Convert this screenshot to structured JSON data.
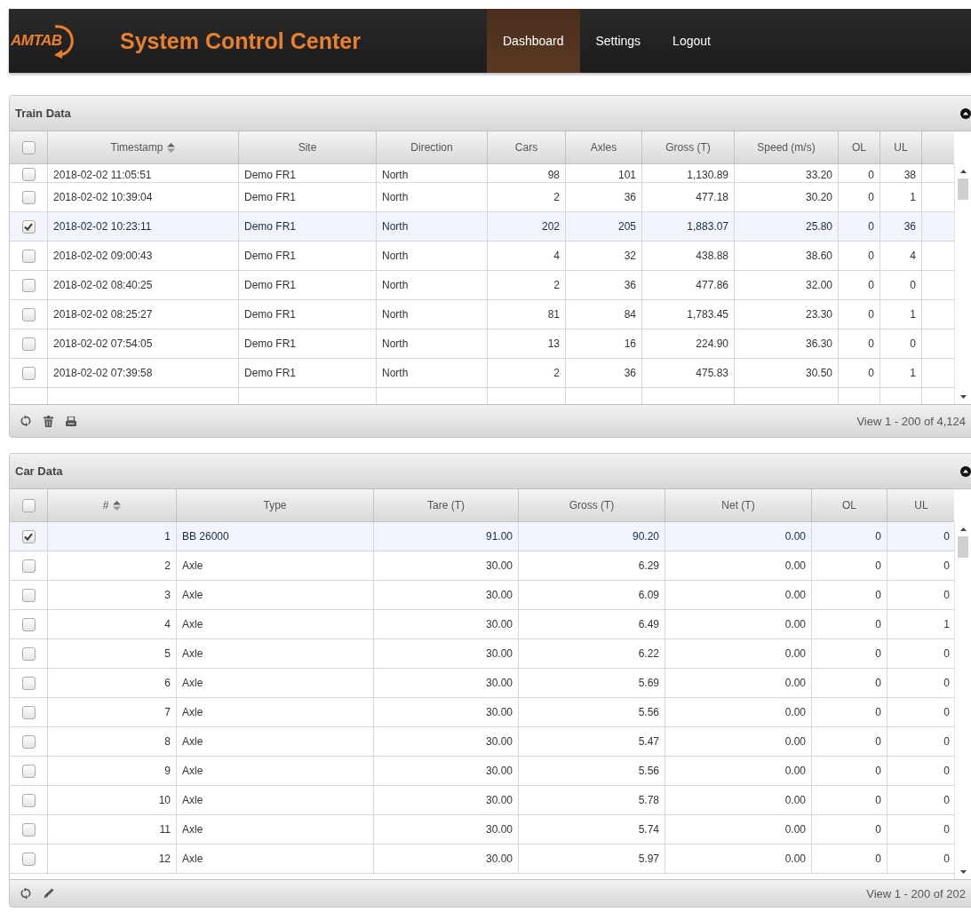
{
  "header": {
    "logo_text": "AMTAB",
    "title": "System Control Center",
    "nav": [
      {
        "label": "Dashboard",
        "selected": true
      },
      {
        "label": "Settings",
        "selected": false
      },
      {
        "label": "Logout",
        "selected": false
      }
    ]
  },
  "panels": [
    {
      "title": "Train Data",
      "select_all_checked": false,
      "columns": [
        {
          "label": "Timestamp",
          "kind": "text",
          "sorted": true
        },
        {
          "label": "Site",
          "kind": "text",
          "sorted": false
        },
        {
          "label": "Direction",
          "kind": "text",
          "sorted": false
        },
        {
          "label": "Cars",
          "kind": "number",
          "sorted": false
        },
        {
          "label": "Axles",
          "kind": "number",
          "sorted": false
        },
        {
          "label": "Gross (T)",
          "kind": "number",
          "sorted": false
        },
        {
          "label": "Speed (m/s)",
          "kind": "number",
          "sorted": false
        },
        {
          "label": "OL",
          "kind": "number",
          "sorted": false
        },
        {
          "label": "UL",
          "kind": "number",
          "sorted": false
        },
        {
          "kind": "blank"
        }
      ],
      "rows": [
        {
          "cells": [
            "2018-02-02 11:05:51",
            "Demo FR1",
            "North",
            "98",
            "101",
            "1,130.89",
            "33.20",
            "0",
            "38",
            ""
          ],
          "checked": false,
          "selected": false
        },
        {
          "cells": [
            "2018-02-02 10:39:04",
            "Demo FR1",
            "North",
            "2",
            "36",
            "477.18",
            "30.20",
            "0",
            "1",
            ""
          ],
          "checked": false,
          "selected": false
        },
        {
          "cells": [
            "2018-02-02 10:23:11",
            "Demo FR1",
            "North",
            "202",
            "205",
            "1,883.07",
            "25.80",
            "0",
            "36",
            ""
          ],
          "checked": true,
          "selected": true
        },
        {
          "cells": [
            "2018-02-02 09:00:43",
            "Demo FR1",
            "North",
            "4",
            "32",
            "438.88",
            "38.60",
            "0",
            "4",
            ""
          ],
          "checked": false,
          "selected": false
        },
        {
          "cells": [
            "2018-02-02 08:40:25",
            "Demo FR1",
            "North",
            "2",
            "36",
            "477.86",
            "32.00",
            "0",
            "0",
            ""
          ],
          "checked": false,
          "selected": false
        },
        {
          "cells": [
            "2018-02-02 08:25:27",
            "Demo FR1",
            "North",
            "81",
            "84",
            "1,783.45",
            "23.30",
            "0",
            "1",
            ""
          ],
          "checked": false,
          "selected": false
        },
        {
          "cells": [
            "2018-02-02 07:54:05",
            "Demo FR1",
            "North",
            "13",
            "16",
            "224.90",
            "36.30",
            "0",
            "0",
            ""
          ],
          "checked": false,
          "selected": false
        },
        {
          "cells": [
            "2018-02-02 07:39:58",
            "Demo FR1",
            "North",
            "2",
            "36",
            "475.83",
            "30.50",
            "0",
            "1",
            ""
          ],
          "checked": false,
          "selected": false
        }
      ],
      "tools": [
        {
          "kind": "refresh"
        },
        {
          "kind": "delete"
        },
        {
          "kind": "print"
        }
      ],
      "pager": "View 1 - 200 of 4,124"
    },
    {
      "title": "Car Data",
      "select_all_checked": false,
      "columns": [
        {
          "label": "#",
          "kind": "number",
          "sorted": true
        },
        {
          "label": "Type",
          "kind": "text",
          "sorted": false
        },
        {
          "label": "Tare (T)",
          "kind": "number",
          "sorted": false
        },
        {
          "label": "Gross (T)",
          "kind": "number",
          "sorted": false
        },
        {
          "label": "Net (T)",
          "kind": "number",
          "sorted": false
        },
        {
          "label": "OL",
          "kind": "number",
          "sorted": false
        },
        {
          "label": "UL",
          "kind": "number",
          "sorted": false
        }
      ],
      "rows": [
        {
          "cells": [
            "1",
            "BB 26000",
            "91.00",
            "90.20",
            "0.00",
            "0",
            "0"
          ],
          "checked": true,
          "selected": true
        },
        {
          "cells": [
            "2",
            "Axle",
            "30.00",
            "6.29",
            "0.00",
            "0",
            "0"
          ],
          "checked": false,
          "selected": false
        },
        {
          "cells": [
            "3",
            "Axle",
            "30.00",
            "6.09",
            "0.00",
            "0",
            "0"
          ],
          "checked": false,
          "selected": false
        },
        {
          "cells": [
            "4",
            "Axle",
            "30.00",
            "6.49",
            "0.00",
            "0",
            "1"
          ],
          "checked": false,
          "selected": false
        },
        {
          "cells": [
            "5",
            "Axle",
            "30.00",
            "6.22",
            "0.00",
            "0",
            "0"
          ],
          "checked": false,
          "selected": false
        },
        {
          "cells": [
            "6",
            "Axle",
            "30.00",
            "5.69",
            "0.00",
            "0",
            "0"
          ],
          "checked": false,
          "selected": false
        },
        {
          "cells": [
            "7",
            "Axle",
            "30.00",
            "5.56",
            "0.00",
            "0",
            "0"
          ],
          "checked": false,
          "selected": false
        },
        {
          "cells": [
            "8",
            "Axle",
            "30.00",
            "5.47",
            "0.00",
            "0",
            "0"
          ],
          "checked": false,
          "selected": false
        },
        {
          "cells": [
            "9",
            "Axle",
            "30.00",
            "5.56",
            "0.00",
            "0",
            "0"
          ],
          "checked": false,
          "selected": false
        },
        {
          "cells": [
            "10",
            "Axle",
            "30.00",
            "5.78",
            "0.00",
            "0",
            "0"
          ],
          "checked": false,
          "selected": false
        },
        {
          "cells": [
            "11",
            "Axle",
            "30.00",
            "5.74",
            "0.00",
            "0",
            "0"
          ],
          "checked": false,
          "selected": false
        },
        {
          "cells": [
            "12",
            "Axle",
            "30.00",
            "5.97",
            "0.00",
            "0",
            "0"
          ],
          "checked": false,
          "selected": false
        }
      ],
      "tools": [
        {
          "kind": "refresh"
        },
        {
          "kind": "edit"
        }
      ],
      "pager": "View 1 - 200 of 202"
    }
  ]
}
